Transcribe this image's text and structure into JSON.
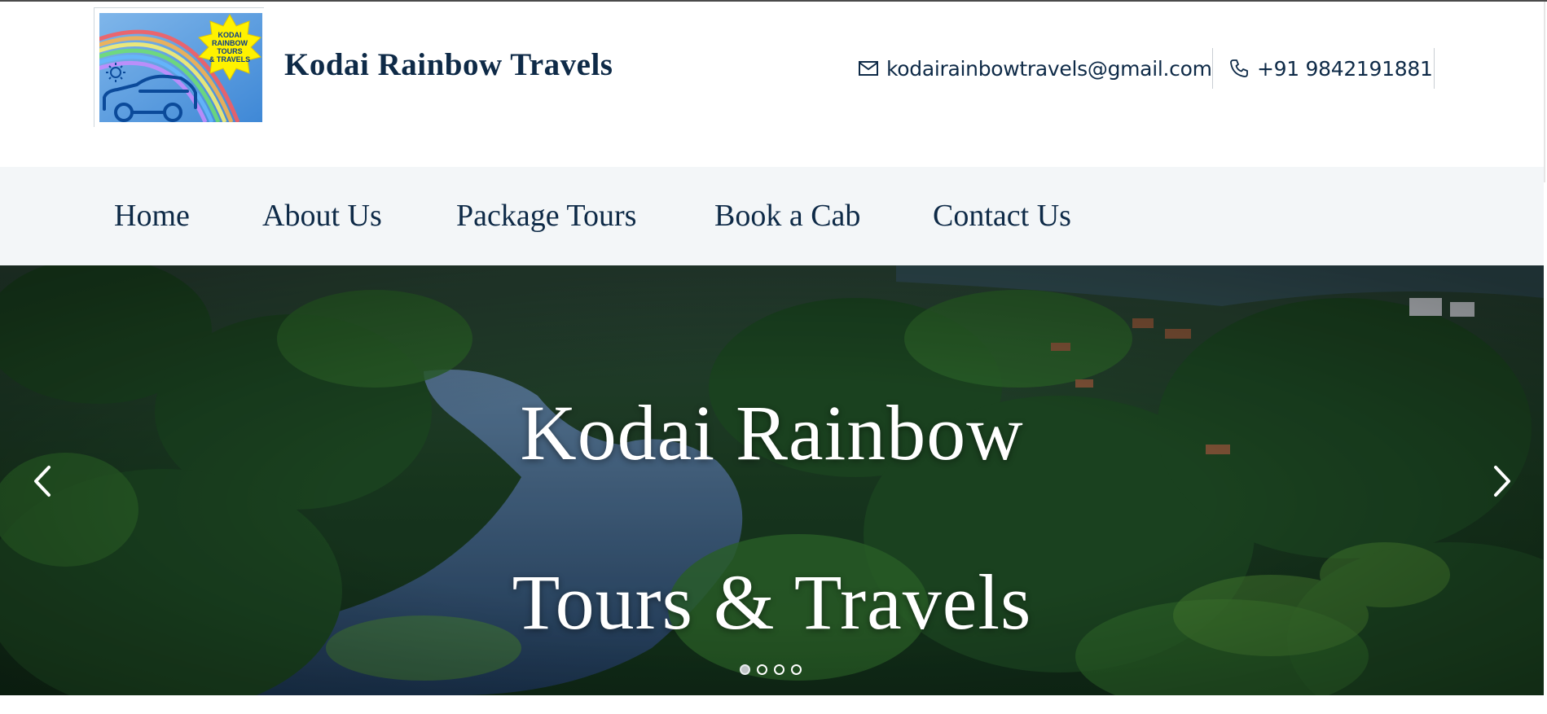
{
  "header": {
    "logo_alt": "Kodai Rainbow Tours & Travels logo",
    "logo_badge_lines": [
      "KODAI",
      "RAINBOW",
      "TOURS",
      "& TRAVELS"
    ],
    "brand_name": "Kodai Rainbow Travels",
    "email": "kodairainbowtravels@gmail.com",
    "phone": "+91 9842191881",
    "email_icon": "envelope-icon",
    "phone_icon": "phone-icon"
  },
  "nav": {
    "items": [
      {
        "label": "Home"
      },
      {
        "label": "About Us"
      },
      {
        "label": "Package Tours"
      },
      {
        "label": "Book a Cab"
      },
      {
        "label": "Contact Us"
      }
    ]
  },
  "hero": {
    "title_line1": "Kodai Rainbow",
    "title_line2": "Tours & Travels",
    "prev_icon": "chevron-left-icon",
    "next_icon": "chevron-right-icon",
    "slide_count": 4,
    "active_slide": 1
  },
  "colors": {
    "brand_navy": "#0e2a47",
    "nav_bg": "#f3f6f8",
    "forest_green": "#1f4a22",
    "lake_blue": "#2c4d6e"
  }
}
